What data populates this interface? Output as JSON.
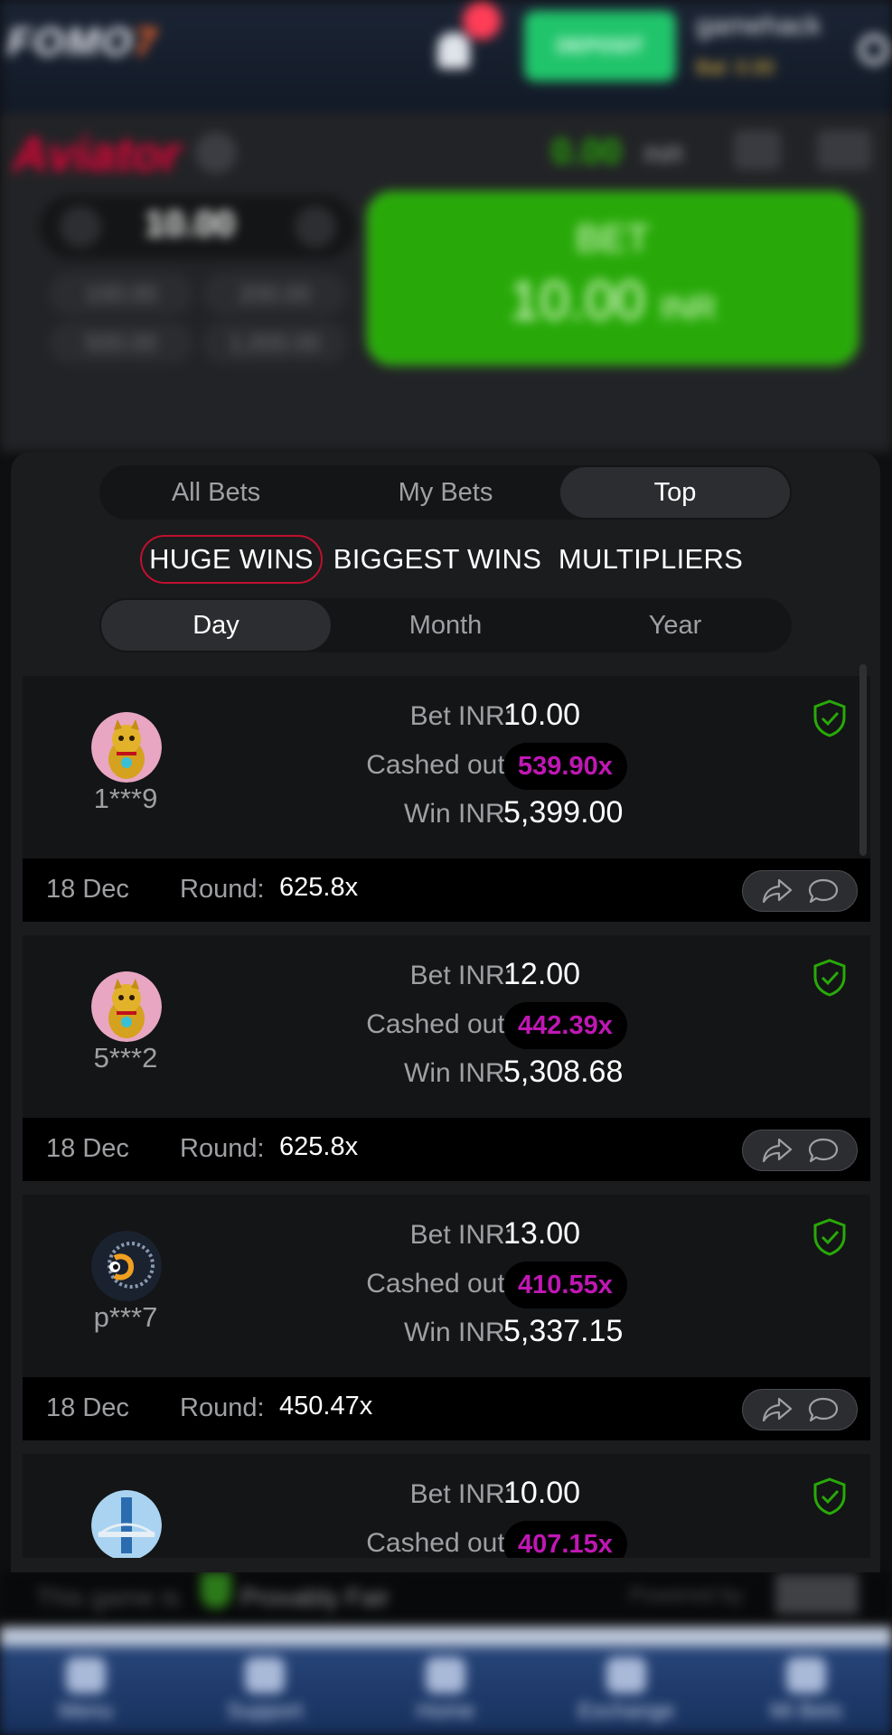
{
  "topbar": {
    "logo_main": "FOMO",
    "logo_accent": "7",
    "deposit_label": "DEPOSIT",
    "username": "gamehack",
    "balance": "Bal: 0.00"
  },
  "game": {
    "title": "Aviator",
    "balance_value": "0.00",
    "balance_currency": "INR",
    "stake_value": "10.00",
    "quick_amounts": [
      "100.00",
      "200.00",
      "500.00",
      "1,000.00"
    ],
    "bet_label": "BET",
    "bet_amount": "10.00",
    "bet_currency": "INR"
  },
  "tabs": [
    {
      "label": "All Bets",
      "active": false
    },
    {
      "label": "My Bets",
      "active": false
    },
    {
      "label": "Top",
      "active": true
    }
  ],
  "categories": [
    {
      "label": "HUGE WINS",
      "active": true
    },
    {
      "label": "BIGGEST WINS",
      "active": false
    },
    {
      "label": "MULTIPLIERS",
      "active": false
    }
  ],
  "periods": [
    {
      "label": "Day",
      "active": true
    },
    {
      "label": "Month",
      "active": false
    },
    {
      "label": "Year",
      "active": false
    }
  ],
  "labels": {
    "bet": "Bet INR:",
    "cashed": "Cashed out:",
    "win": "Win INR:",
    "round": "Round:"
  },
  "bets": [
    {
      "user": "1***9",
      "avatar": "lucky-cat-avatar",
      "bet": "10.00",
      "cashed_out": "539.90x",
      "win": "5,399.00",
      "date": "18 Dec",
      "round": "625.8x"
    },
    {
      "user": "5***2",
      "avatar": "lucky-cat-avatar",
      "bet": "12.00",
      "cashed_out": "442.39x",
      "win": "5,308.68",
      "date": "18 Dec",
      "round": "625.8x"
    },
    {
      "user": "p***7",
      "avatar": "dark-creature-avatar",
      "bet": "13.00",
      "cashed_out": "410.55x",
      "win": "5,337.15",
      "date": "18 Dec",
      "round": "450.47x"
    },
    {
      "user": "",
      "avatar": "city-tower-avatar",
      "bet": "10.00",
      "cashed_out": "407.15x",
      "win": "",
      "date": "",
      "round": ""
    }
  ],
  "footer": {
    "game_text": "This game is",
    "fair_label": "Provably Fair",
    "powered": "Powered by",
    "provider": "SPRIBE"
  },
  "bottom_nav": [
    {
      "label": "Menu",
      "icon": "menu-icon"
    },
    {
      "label": "Support",
      "icon": "support-icon"
    },
    {
      "label": "Home",
      "icon": "home-icon"
    },
    {
      "label": "Exchange",
      "icon": "exchange-icon"
    },
    {
      "label": "Mi Bets",
      "icon": "bets-icon"
    }
  ],
  "colors": {
    "accent_red": "#e50539",
    "bet_green": "#28a909",
    "multiplier_purple": "#c017b4",
    "fair_green": "#28a909"
  }
}
